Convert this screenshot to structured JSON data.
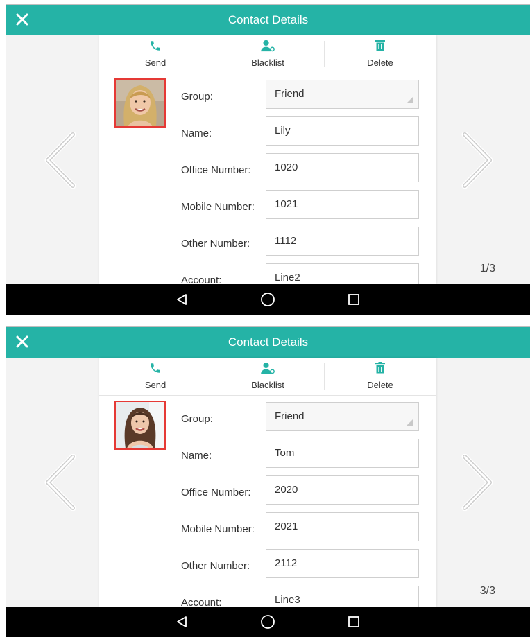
{
  "colors": {
    "accent": "#25b3a6",
    "photo_border": "#e53935",
    "navbar": "#000000"
  },
  "screens": [
    {
      "title": "Contact Details",
      "actions": [
        {
          "label": "Send",
          "icon": "phone-icon"
        },
        {
          "label": "Blacklist",
          "icon": "person-block-icon"
        },
        {
          "label": "Delete",
          "icon": "trash-icon"
        }
      ],
      "fields": [
        {
          "label": "Group:",
          "value": "Friend"
        },
        {
          "label": "Name:",
          "value": "Lily"
        },
        {
          "label": "Office Number:",
          "value": "1020"
        },
        {
          "label": "Mobile Number:",
          "value": "1021"
        },
        {
          "label": "Other Number:",
          "value": "1112"
        },
        {
          "label": "Account:",
          "value": "Line2"
        }
      ],
      "page": "1/3"
    },
    {
      "title": "Contact Details",
      "actions": [
        {
          "label": "Send",
          "icon": "phone-icon"
        },
        {
          "label": "Blacklist",
          "icon": "person-block-icon"
        },
        {
          "label": "Delete",
          "icon": "trash-icon"
        }
      ],
      "fields": [
        {
          "label": "Group:",
          "value": "Friend"
        },
        {
          "label": "Name:",
          "value": "Tom"
        },
        {
          "label": "Office Number:",
          "value": "2020"
        },
        {
          "label": "Mobile Number:",
          "value": "2021"
        },
        {
          "label": "Other Number:",
          "value": "2112"
        },
        {
          "label": "Account:",
          "value": "Line3"
        }
      ],
      "page": "3/3"
    }
  ]
}
